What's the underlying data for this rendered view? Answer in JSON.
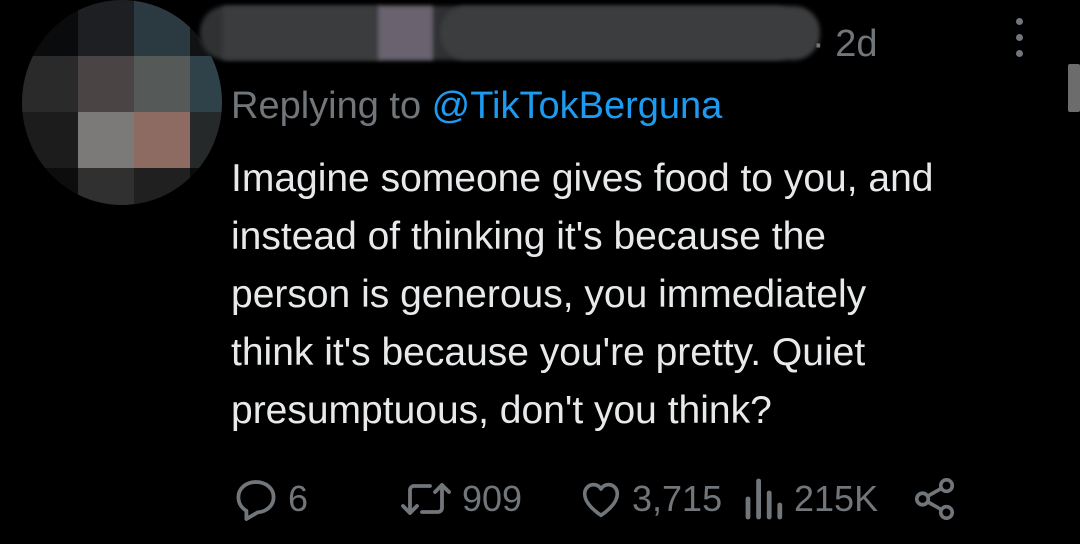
{
  "tweet": {
    "timestamp": "· 2d",
    "replying_prefix": "Replying to ",
    "replying_mention": "@TikTokBerguna",
    "body_lines": [
      "Imagine someone gives food to you, and",
      "instead of thinking it's because the",
      "person is generous, you immediately",
      "think it's because you're pretty. Quiet",
      "presumptuous, don't you think?"
    ],
    "actions": {
      "reply_count": "6",
      "retweet_count": "909",
      "like_count": "3,715",
      "views_count": "215K"
    }
  },
  "icons": {
    "reply": "reply-icon",
    "retweet": "retweet-icon",
    "like": "like-icon",
    "views": "views-icon",
    "share": "share-icon",
    "more": "more-options-icon"
  },
  "colors": {
    "background": "#000000",
    "text": "#e7e9ea",
    "secondary": "#71767b",
    "link": "#1d9bf0"
  }
}
